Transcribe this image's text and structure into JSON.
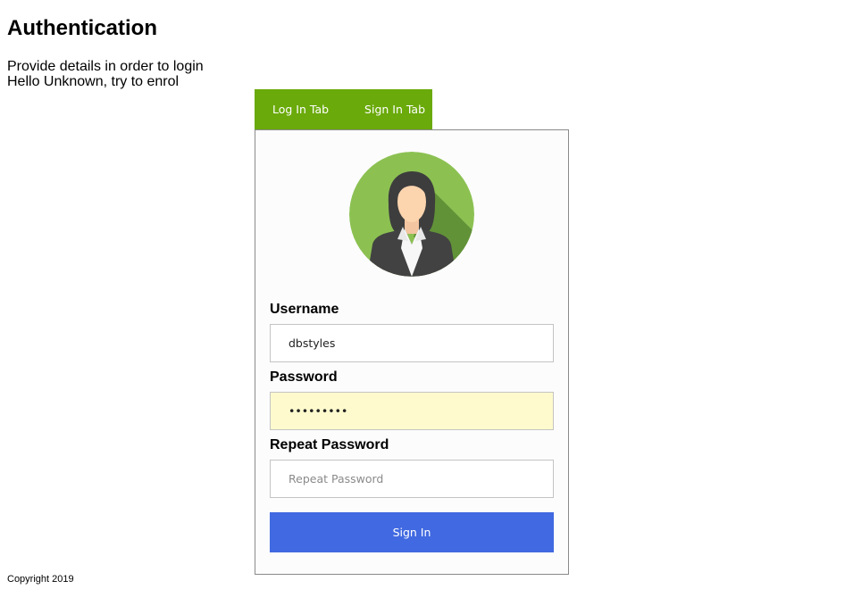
{
  "page": {
    "title": "Authentication",
    "intro_line1": "Provide details in order to login",
    "intro_line2": "Hello Unknown, try to enrol"
  },
  "tabs": [
    {
      "label": "Log In Tab"
    },
    {
      "label": "Sign In Tab"
    }
  ],
  "avatar": {
    "icon": "female-user-avatar-icon",
    "background": "#8cc152"
  },
  "form": {
    "username_label": "Username",
    "username_value": "dbstyles",
    "password_label": "Password",
    "password_value": "•••••••••",
    "repeat_label": "Repeat Password",
    "repeat_placeholder": "Repeat Password",
    "submit_label": "Sign In"
  },
  "footer": {
    "copyright": "Copyright 2019"
  },
  "colors": {
    "tab_bar": "#6aaa0a",
    "submit_button": "#4169e1",
    "autofill_field": "#fefacd",
    "card_background": "#fcfcfc"
  }
}
